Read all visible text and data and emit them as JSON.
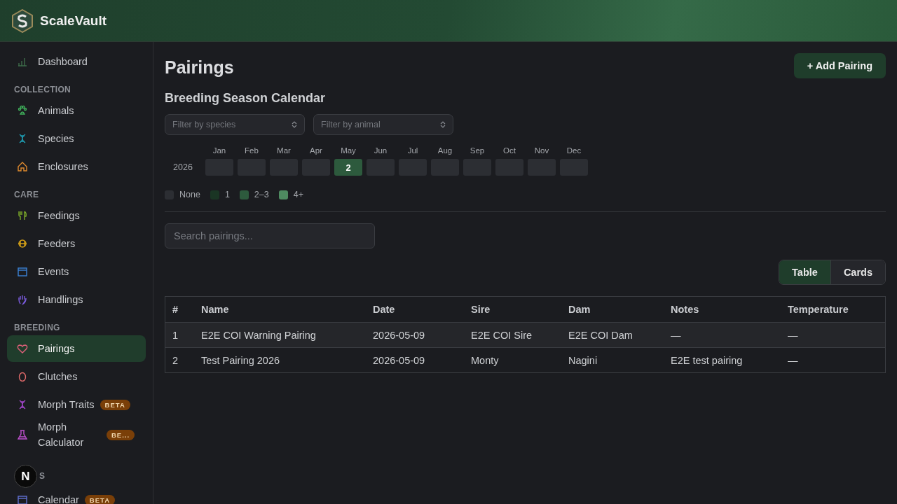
{
  "app": {
    "name": "ScaleVault"
  },
  "sidebar": {
    "sections": [
      {
        "items": [
          {
            "label": "Dashboard",
            "selected": false
          }
        ]
      },
      {
        "label": "COLLECTION",
        "items": [
          {
            "label": "Animals",
            "selected": false
          },
          {
            "label": "Species",
            "selected": false
          },
          {
            "label": "Enclosures",
            "selected": false
          }
        ]
      },
      {
        "label": "CARE",
        "items": [
          {
            "label": "Feedings",
            "selected": false
          },
          {
            "label": "Feeders",
            "selected": false
          },
          {
            "label": "Events",
            "selected": false
          },
          {
            "label": "Handlings",
            "selected": false
          }
        ]
      },
      {
        "label": "BREEDING",
        "items": [
          {
            "label": "Pairings",
            "selected": true
          },
          {
            "label": "Clutches",
            "selected": false
          },
          {
            "label": "Morph Traits",
            "selected": false,
            "badge": "BETA"
          },
          {
            "label": "Morph Calculator",
            "selected": false,
            "badge": "BE..."
          }
        ]
      },
      {
        "label": "S",
        "items": [
          {
            "label": "Calendar",
            "selected": false,
            "badge": "BETA"
          }
        ]
      }
    ]
  },
  "dev_indicator": {
    "label": "N"
  },
  "page": {
    "title": "Pairings",
    "add_button": "+ Add Pairing"
  },
  "calendar": {
    "title": "Breeding Season Calendar",
    "filters": [
      {
        "placeholder": "Filter by species"
      },
      {
        "placeholder": "Filter by animal"
      }
    ],
    "months": [
      "Jan",
      "Feb",
      "Mar",
      "Apr",
      "May",
      "Jun",
      "Jul",
      "Aug",
      "Sep",
      "Oct",
      "Nov",
      "Dec"
    ],
    "year": "2026",
    "cells": [
      {
        "color": "#2c2e33"
      },
      {
        "color": "#2c2e33"
      },
      {
        "color": "#2c2e33"
      },
      {
        "color": "#2c2e33"
      },
      {
        "count": "2",
        "color": "#2d5a3d"
      },
      {
        "color": "#2c2e33"
      },
      {
        "color": "#2c2e33"
      },
      {
        "color": "#2c2e33"
      },
      {
        "color": "#2c2e33"
      },
      {
        "color": "#2c2e33"
      },
      {
        "color": "#2c2e33"
      },
      {
        "color": "#2c2e33"
      }
    ],
    "legend": [
      {
        "label": "None",
        "color": "#2c2e33"
      },
      {
        "label": "1",
        "color": "#1a3524"
      },
      {
        "label": "2–3",
        "color": "#2d5a3d"
      },
      {
        "label": "4+",
        "color": "#4e8a60"
      }
    ]
  },
  "search": {
    "placeholder": "Search pairings..."
  },
  "view_toggle": [
    {
      "label": "Table",
      "selected": true
    },
    {
      "label": "Cards",
      "selected": false
    }
  ],
  "table": {
    "columns": [
      "#",
      "Name",
      "Date",
      "Sire",
      "Dam",
      "Notes",
      "Temperature"
    ],
    "rows": [
      [
        "1",
        "E2E COI Warning Pairing",
        "2026-05-09",
        "E2E COI Sire",
        "E2E COI Dam",
        "—",
        "—"
      ],
      [
        "2",
        "Test Pairing 2026",
        "2026-05-09",
        "Monty",
        "Nagini",
        "E2E test pairing",
        "—"
      ]
    ]
  }
}
